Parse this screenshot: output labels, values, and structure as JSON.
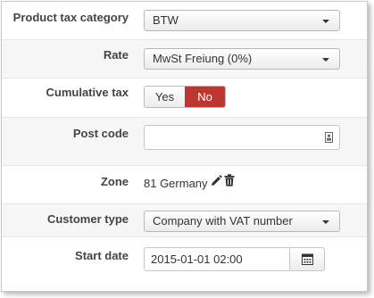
{
  "form": {
    "product_tax_category": {
      "label": "Product tax category",
      "value": "BTW"
    },
    "rate": {
      "label": "Rate",
      "value": "MwSt Freiung (0%)"
    },
    "cumulative_tax": {
      "label": "Cumulative tax",
      "yes_label": "Yes",
      "no_label": "No",
      "selected": "No"
    },
    "post_code": {
      "label": "Post code",
      "value": "",
      "icon": "contact-card-icon"
    },
    "zone": {
      "label": "Zone",
      "value": "81 Germany",
      "edit_icon": "pencil-icon",
      "delete_icon": "trash-icon"
    },
    "customer_type": {
      "label": "Customer type",
      "value": "Company with VAT number"
    },
    "start_date": {
      "label": "Start date",
      "value": "2015-01-01 02:00",
      "icon": "calendar-icon"
    }
  },
  "colors": {
    "toggle_active": "#bd362f",
    "row_alt": "#f7f7f7",
    "border": "#c9c9c9"
  }
}
